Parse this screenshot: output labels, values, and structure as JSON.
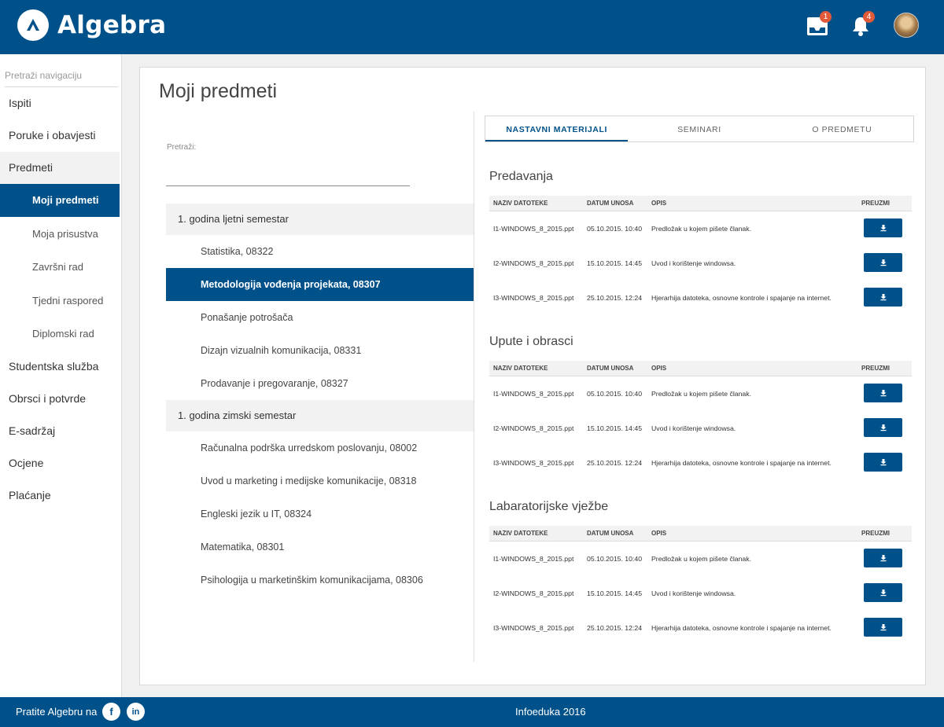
{
  "app": {
    "name": "Algebra"
  },
  "header": {
    "inbox_count": "1",
    "notifications_count": "4"
  },
  "sidebar": {
    "search_placeholder": "Pretraži navigaciju",
    "items": [
      {
        "label": "Ispiti"
      },
      {
        "label": "Poruke i obavjesti"
      },
      {
        "label": "Predmeti"
      },
      {
        "label": "Studentska služba"
      },
      {
        "label": "Obrsci i potvrde"
      },
      {
        "label": "E-sadržaj"
      },
      {
        "label": "Ocjene"
      },
      {
        "label": "Plaćanje"
      }
    ],
    "sub_items": [
      {
        "label": "Moji predmeti"
      },
      {
        "label": "Moja prisustva"
      },
      {
        "label": "Završni rad"
      },
      {
        "label": "Tjedni raspored"
      },
      {
        "label": "Diplomski rad"
      }
    ]
  },
  "main": {
    "title": "Moji predmeti",
    "search_label": "Pretraži:",
    "semesters": [
      {
        "title": "1. godina ljetni semestar",
        "subjects": [
          "Statistika, 08322",
          "Metodologija vođenja projekata, 08307",
          "Ponašanje potrošača",
          "Dizajn vizualnih komunikacija, 08331",
          "Prodavanje i pregovaranje, 08327"
        ]
      },
      {
        "title": "1. godina zimski semestar",
        "subjects": [
          "Računalna podrška urredskom poslovanju, 08002",
          "Uvod u marketing i medijske komunikacije, 08318",
          "Engleski jezik u IT, 08324",
          "Matematika, 08301",
          "Psihologija u marketinškim komunikacijama, 08306"
        ]
      }
    ]
  },
  "tabs": [
    {
      "label": "NASTAVNI MATERIJALI"
    },
    {
      "label": "SEMINARI"
    },
    {
      "label": "O PREDMETU"
    }
  ],
  "table_columns": [
    "NAZIV DATOTEKE",
    "DATUM UNOSA",
    "OPIS",
    "PREUZMI"
  ],
  "sections": [
    {
      "title": "Predavanja",
      "rows": [
        {
          "file": "I1-WINDOWS_8_2015.ppt",
          "date": "05.10.2015. 10:40",
          "desc": "Predložak u kojem pišete članak."
        },
        {
          "file": "I2-WINDOWS_8_2015.ppt",
          "date": "15.10.2015. 14:45",
          "desc": "Uvod i korištenje windowsa."
        },
        {
          "file": "I3-WINDOWS_8_2015.ppt",
          "date": "25.10.2015. 12:24",
          "desc": "Hjerarhija datoteka, osnovne kontrole i spajanje na internet."
        }
      ]
    },
    {
      "title": "Upute i obrasci",
      "rows": [
        {
          "file": "I1-WINDOWS_8_2015.ppt",
          "date": "05.10.2015. 10:40",
          "desc": "Predložak u kojem pišete članak."
        },
        {
          "file": "I2-WINDOWS_8_2015.ppt",
          "date": "15.10.2015. 14:45",
          "desc": "Uvod i korištenje windowsa."
        },
        {
          "file": "I3-WINDOWS_8_2015.ppt",
          "date": "25.10.2015. 12:24",
          "desc": "Hjerarhija datoteka, osnovne kontrole i spajanje na internet."
        }
      ]
    },
    {
      "title": "Labaratorijske vježbe",
      "rows": [
        {
          "file": "I1-WINDOWS_8_2015.ppt",
          "date": "05.10.2015. 10:40",
          "desc": "Predložak u kojem pišete članak."
        },
        {
          "file": "I2-WINDOWS_8_2015.ppt",
          "date": "15.10.2015. 14:45",
          "desc": "Uvod i korištenje windowsa."
        },
        {
          "file": "I3-WINDOWS_8_2015.ppt",
          "date": "25.10.2015. 12:24",
          "desc": "Hjerarhija datoteka, osnovne kontrole i spajanje na internet."
        }
      ]
    }
  ],
  "footer": {
    "follow_text": "Pratite Algebru na",
    "center_text": "Infoeduka  2016"
  },
  "colors": {
    "brand": "#00518a",
    "badge": "#e05a3a"
  }
}
